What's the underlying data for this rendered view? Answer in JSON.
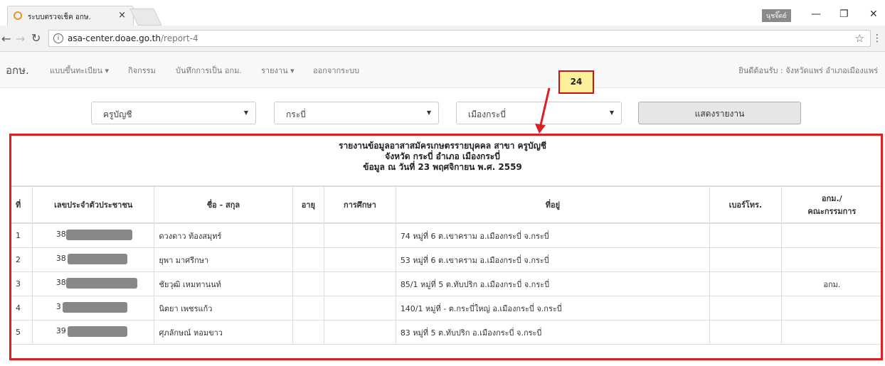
{
  "browser": {
    "tab_title": "ระบบตรวจเช็ค อกษ.",
    "tab_close": "×",
    "user_badge": "นุชจิ๊ดย์",
    "url_host": "asa-center.doae.go.th",
    "url_path": "/report-4",
    "window_minimize": "—",
    "window_maximize": "❐",
    "window_close": "✕"
  },
  "navbar": {
    "brand": "อกษ.",
    "items": [
      {
        "label": "แบบขึ้นทะเบียน ▾"
      },
      {
        "label": "กิจกรรม"
      },
      {
        "label": "บันทึกการเป็น อกม."
      },
      {
        "label": "รายงาน ▾"
      },
      {
        "label": "ออกจากระบบ"
      }
    ],
    "welcome": "ยินดีต้อนรับ : จังหวัดแพร่ อำเภอเมืองแพร่"
  },
  "filters": {
    "branch": "ครูบัญชี",
    "province": "กระบี่",
    "district": "เมืองกระบี่",
    "show_button": "แสดงรายงาน"
  },
  "annotation": {
    "label": "24",
    "color": "#dd1f1f"
  },
  "report": {
    "title_line1": "รายงานข้อมูลอาสาสมัครเกษตรรายบุคคล สาขา ครูบัญชี",
    "title_line2": "จังหวัด กระบี่ อำเภอ เมืองกระบี่",
    "title_line3": "ข้อมูล ณ วันที่ 23 พฤศจิกายน พ.ศ. 2559",
    "headers": {
      "no": "ที่",
      "id": "เลขประจำตัวประชาชน",
      "name": "ชื่อ - สกุล",
      "age": "อายุ",
      "education": "การศึกษา",
      "address": "ที่อยู่",
      "phone": "เบอร์โทร.",
      "role_line1": "อกม./",
      "role_line2": "คณะกรรมการ"
    },
    "rows": [
      {
        "no": "1",
        "id_prefix": "38",
        "name": "ดวงดาว ท้องสมุทร์",
        "age": "",
        "education": "",
        "address": "74 หมู่ที่ 6 ต.เขาคราม อ.เมืองกระบี่ จ.กระบี่",
        "phone": "",
        "role": ""
      },
      {
        "no": "2",
        "id_prefix": "38",
        "name": "ยุพา มาศรีกษา",
        "age": "",
        "education": "",
        "address": "53 หมู่ที่ 6 ต.เขาคราม อ.เมืองกระบี่ จ.กระบี่",
        "phone": "",
        "role": ""
      },
      {
        "no": "3",
        "id_prefix": "38",
        "name": "ชัยวุฒิ เหมทานนท์",
        "age": "",
        "education": "",
        "address": "85/1 หมู่ที่ 5 ต.ทับปริก อ.เมืองกระบี่ จ.กระบี่",
        "phone": "",
        "role": "อกม."
      },
      {
        "no": "4",
        "id_prefix": "3",
        "name": "นิตยา เพชรแก้ว",
        "age": "",
        "education": "",
        "address": "140/1 หมู่ที่ - ต.กระบี่ใหญ่ อ.เมืองกระบี่ จ.กระบี่",
        "phone": "",
        "role": ""
      },
      {
        "no": "5",
        "id_prefix": "39",
        "name": "ศุภลักษณ์ หอมขาว",
        "age": "",
        "education": "",
        "address": "83 หมู่ที่ 5 ต.ทับปริก อ.เมืองกระบี่ จ.กระบี่",
        "phone": "",
        "role": ""
      }
    ]
  }
}
